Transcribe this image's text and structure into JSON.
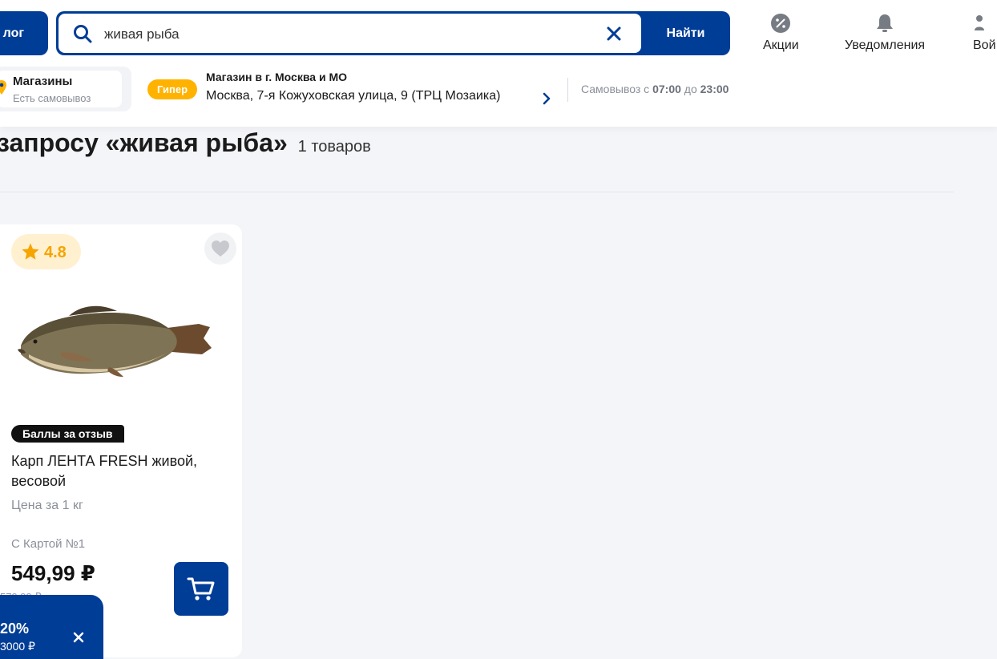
{
  "header": {
    "catalog_label": "лог",
    "search": {
      "value": "живая рыба",
      "button_label": "Найти"
    },
    "actions": [
      {
        "label": "Акции",
        "icon": "percent-badge-icon"
      },
      {
        "label": "Уведомления",
        "icon": "bell-icon"
      },
      {
        "label": "Вой",
        "icon": "user-icon"
      }
    ]
  },
  "store_bar": {
    "stores_title": "Магазины",
    "stores_subtitle": "Есть самовывоз",
    "badge": "Гипер",
    "store_title": "Магазин в г. Москва и МО",
    "store_address": "Москва, 7-я Кожуховская улица, 9 (ТРЦ Мозаика)",
    "pickup_prefix": "Самовывоз с",
    "pickup_from": "07:00",
    "pickup_mid": "до",
    "pickup_to": "23:00"
  },
  "results": {
    "title": "запросу «живая рыба»",
    "count": "1 товаров"
  },
  "product": {
    "rating": "4.8",
    "badge": "Баллы за отзыв",
    "name": "Карп ЛЕНТА FRESH живой, весовой",
    "unit_price": "Цена за 1 кг",
    "card_label": "С Картой №1",
    "price": "549,99 ₽",
    "old_price": "579,99 ₽"
  },
  "promo": {
    "percent": "20%",
    "subtitle": "3000 ₽"
  },
  "colors": {
    "brand_blue": "#003d96",
    "hyper_yellow": "#ffb300",
    "rating_star": "#f5a400"
  }
}
